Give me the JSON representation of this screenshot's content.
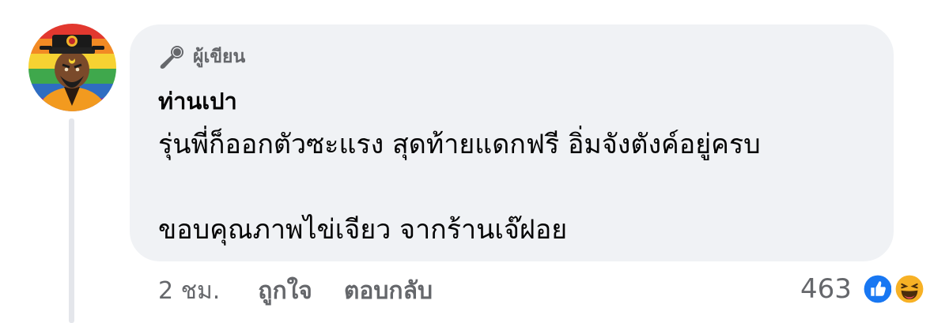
{
  "comment": {
    "badge": {
      "icon": "microphone-icon",
      "label": "ผู้เขียน"
    },
    "author": "ท่านเปา",
    "lines": [
      "รุ่นพี่ก็ออกตัวซะแรง สุดท้ายแดกฟรี อิ่มจังตังค์อยู่ครบ",
      "ขอบคุณภาพไข่เจียว จากร้านเจ๊ฝอย"
    ],
    "actions": {
      "timestamp": "2 ชม.",
      "like_label": "ถูกใจ",
      "reply_label": "ตอบกลับ"
    },
    "reactions": {
      "count": "463",
      "icons": [
        "like-reaction-icon",
        "haha-reaction-icon"
      ]
    }
  },
  "colors": {
    "bubble": "#f0f2f5",
    "secondary_text": "#65676b",
    "primary_text": "#050505",
    "like_blue": "#1877f2",
    "haha_yellow": "#f7b125"
  }
}
